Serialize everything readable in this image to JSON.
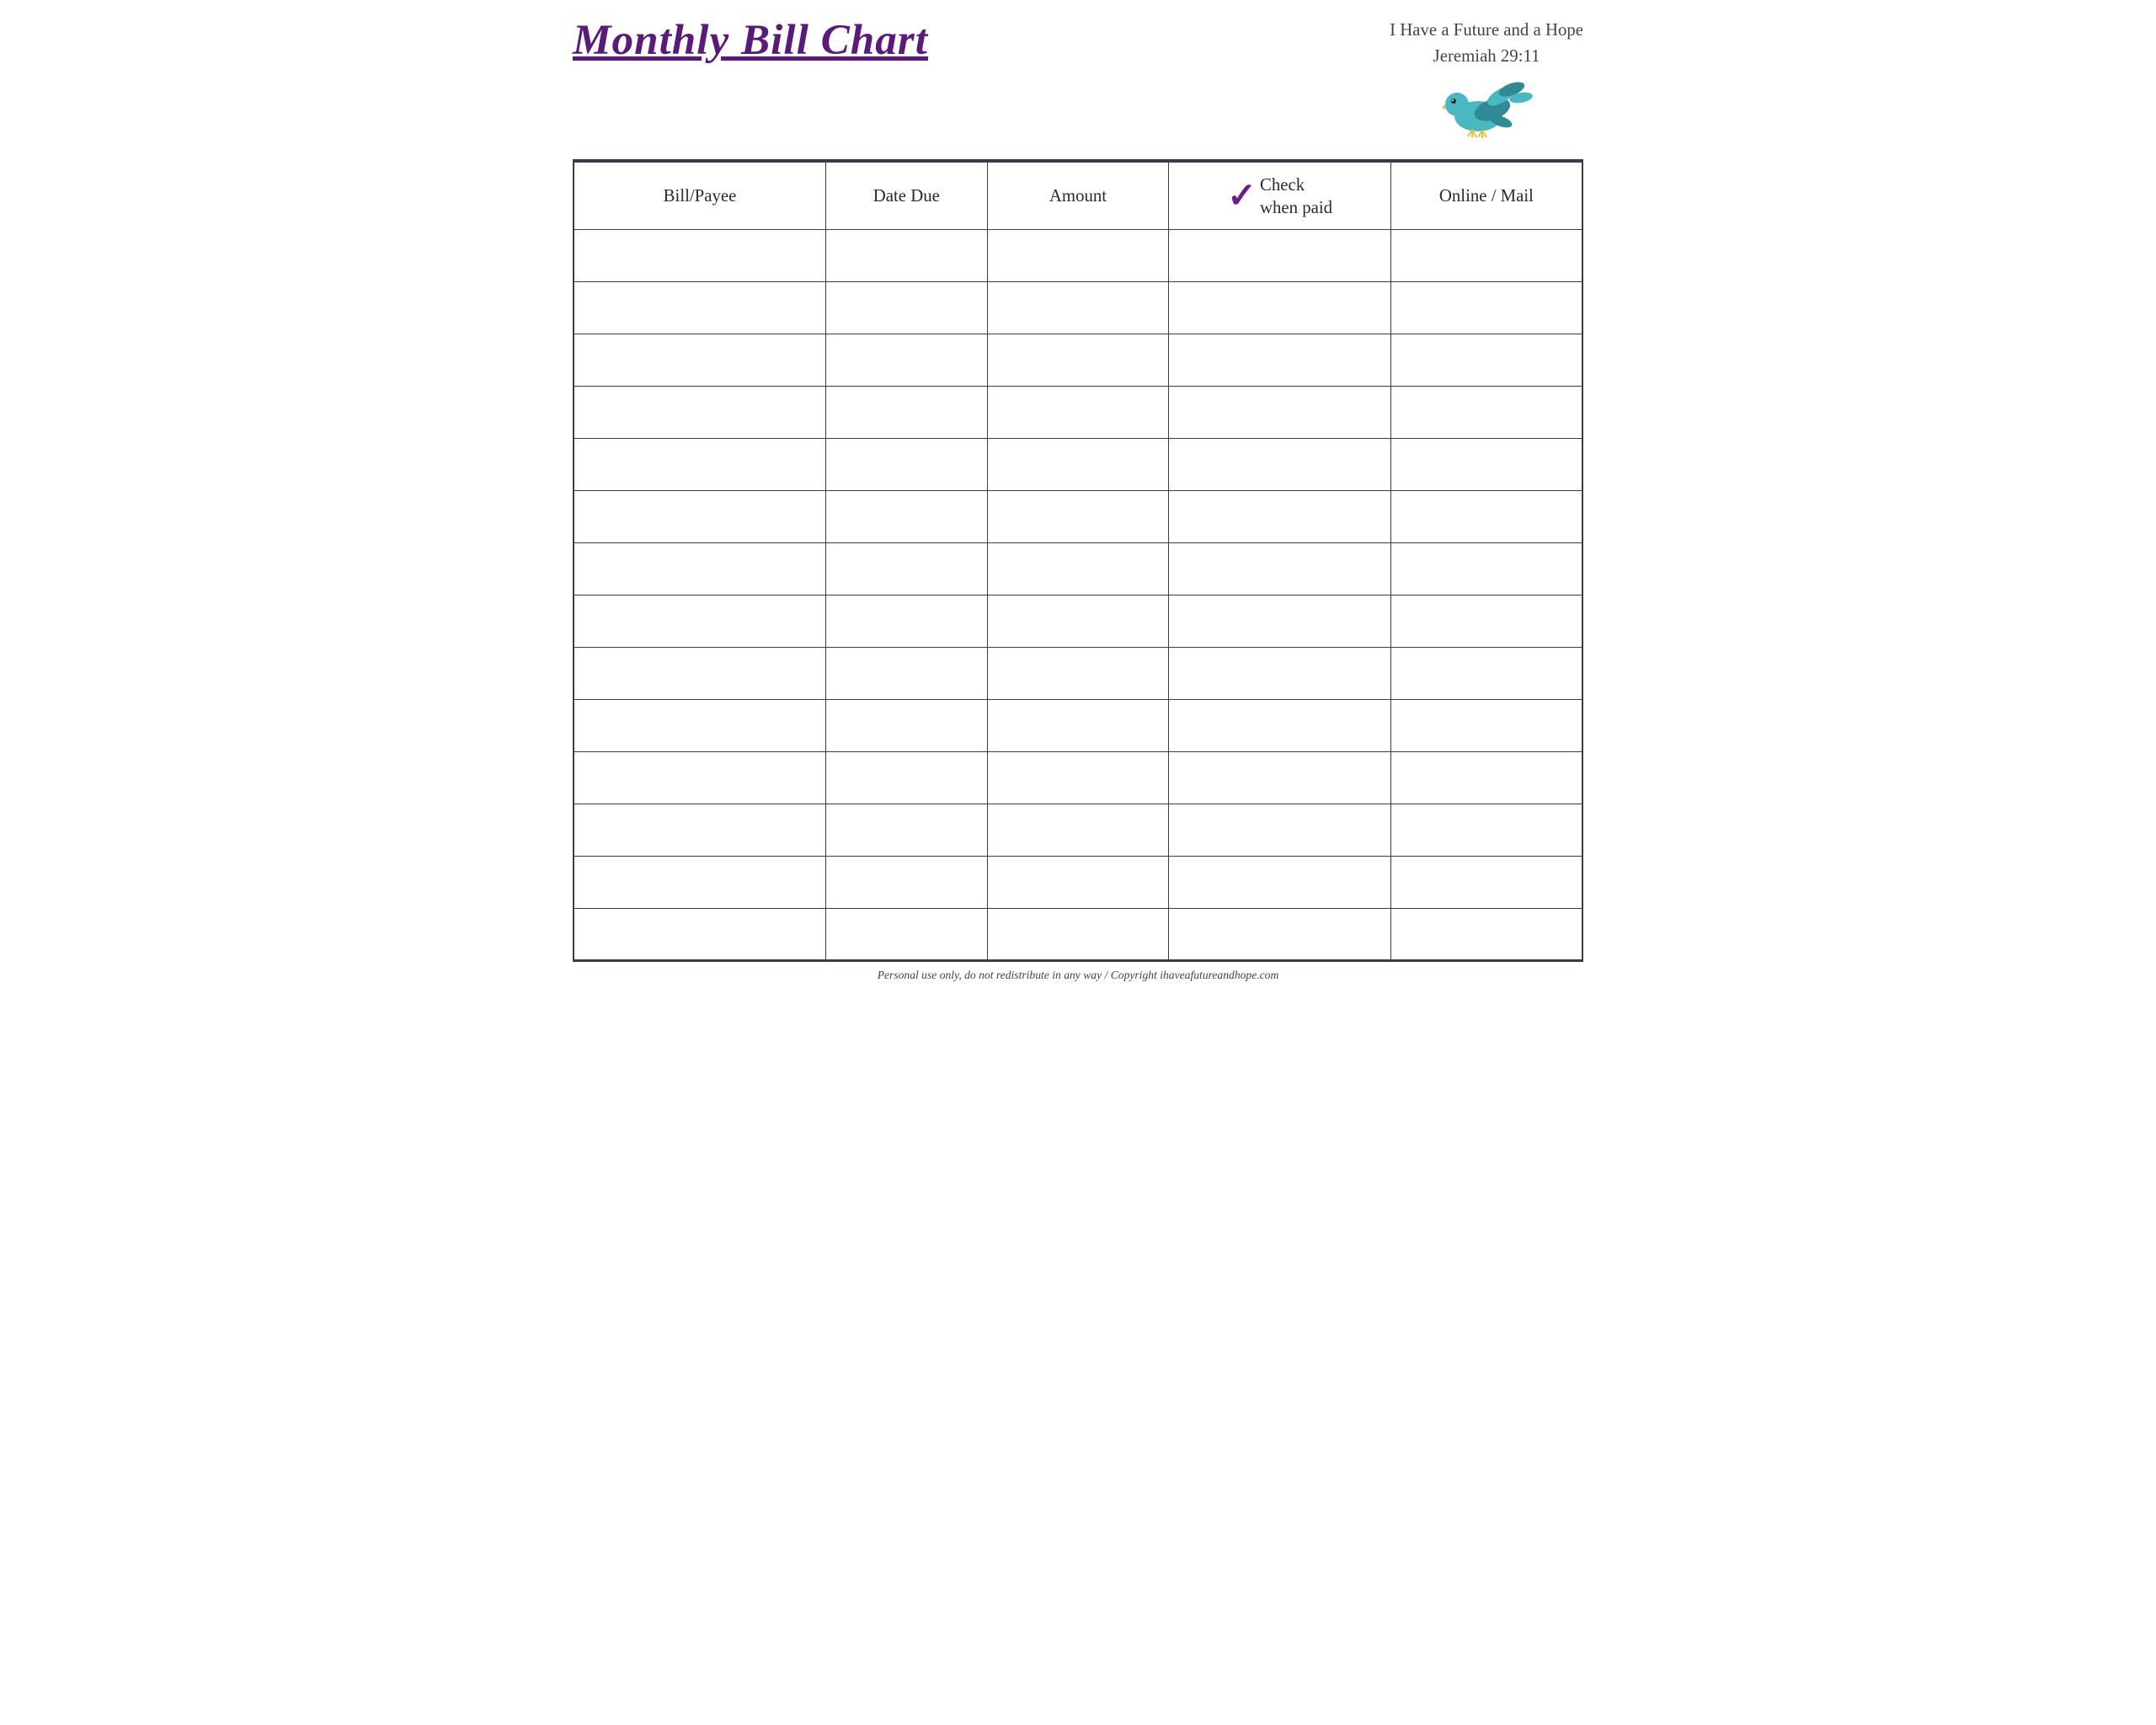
{
  "header": {
    "title": "Monthly Bill Chart",
    "subtitle_line1": "I Have a Future and a Hope",
    "subtitle_line2": "Jeremiah 29:11"
  },
  "table": {
    "columns": [
      {
        "id": "bill_payee",
        "label": "Bill/Payee"
      },
      {
        "id": "date_due",
        "label": "Date Due"
      },
      {
        "id": "amount",
        "label": "Amount"
      },
      {
        "id": "check_when_paid",
        "label_line1": "Check",
        "label_line2": "when paid",
        "checkmark": "✓"
      },
      {
        "id": "online_mail",
        "label": "Online / Mail"
      }
    ],
    "row_count": 14
  },
  "footer": {
    "text": "Personal use only, do not redistribute in any way / Copyright ihaveafutureandhope.com"
  },
  "colors": {
    "title_purple": "#5a1a7a",
    "border_dark": "#3a3a4a",
    "checkmark_purple": "#6a2090",
    "bird_teal": "#4ab8c0",
    "bird_dark_teal": "#2e8a95",
    "bird_yellow_beak": "#e8c040",
    "bird_eye": "#2a2a2a"
  }
}
